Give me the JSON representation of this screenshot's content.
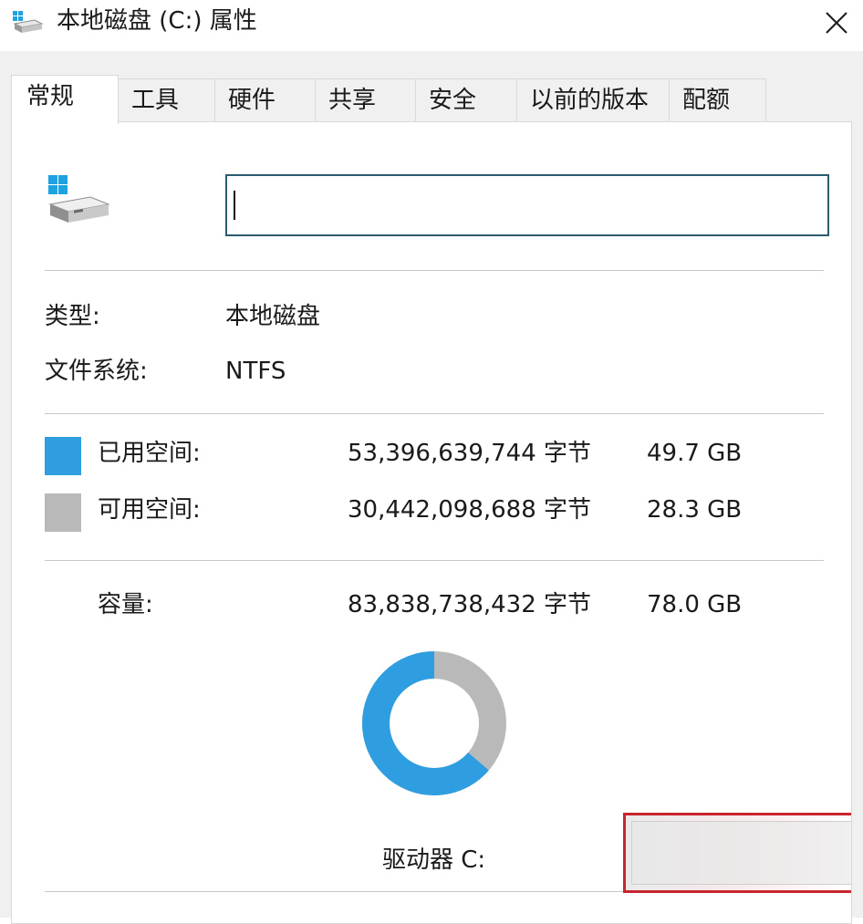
{
  "window": {
    "title": "本地磁盘 (C:) 属性",
    "close_glyph": "✕"
  },
  "tabs": [
    {
      "label": "常规",
      "active": true
    },
    {
      "label": "工具"
    },
    {
      "label": "硬件"
    },
    {
      "label": "共享"
    },
    {
      "label": "安全"
    },
    {
      "label": "以前的版本"
    },
    {
      "label": "配额"
    }
  ],
  "general": {
    "name_value": "",
    "type_label": "类型:",
    "type_value": "本地磁盘",
    "fs_label": "文件系统:",
    "fs_value": "NTFS",
    "used_label": "已用空间:",
    "used_bytes": "53,396,639,744 字节",
    "used_size": "49.7 GB",
    "free_label": "可用空间:",
    "free_bytes": "30,442,098,688 字节",
    "free_size": "28.3 GB",
    "capacity_label": "容量:",
    "capacity_bytes": "83,838,738,432 字节",
    "capacity_size": "78.0 GB",
    "drive_label": "驱动器 C:",
    "used_fraction": 0.637
  },
  "colors": {
    "used": "#2f9ee0",
    "free": "#b9b9b9",
    "accent_border": "#c8262e"
  },
  "icons": {
    "title": "drive-icon",
    "close": "close-icon",
    "drive": "windows-drive-icon"
  }
}
